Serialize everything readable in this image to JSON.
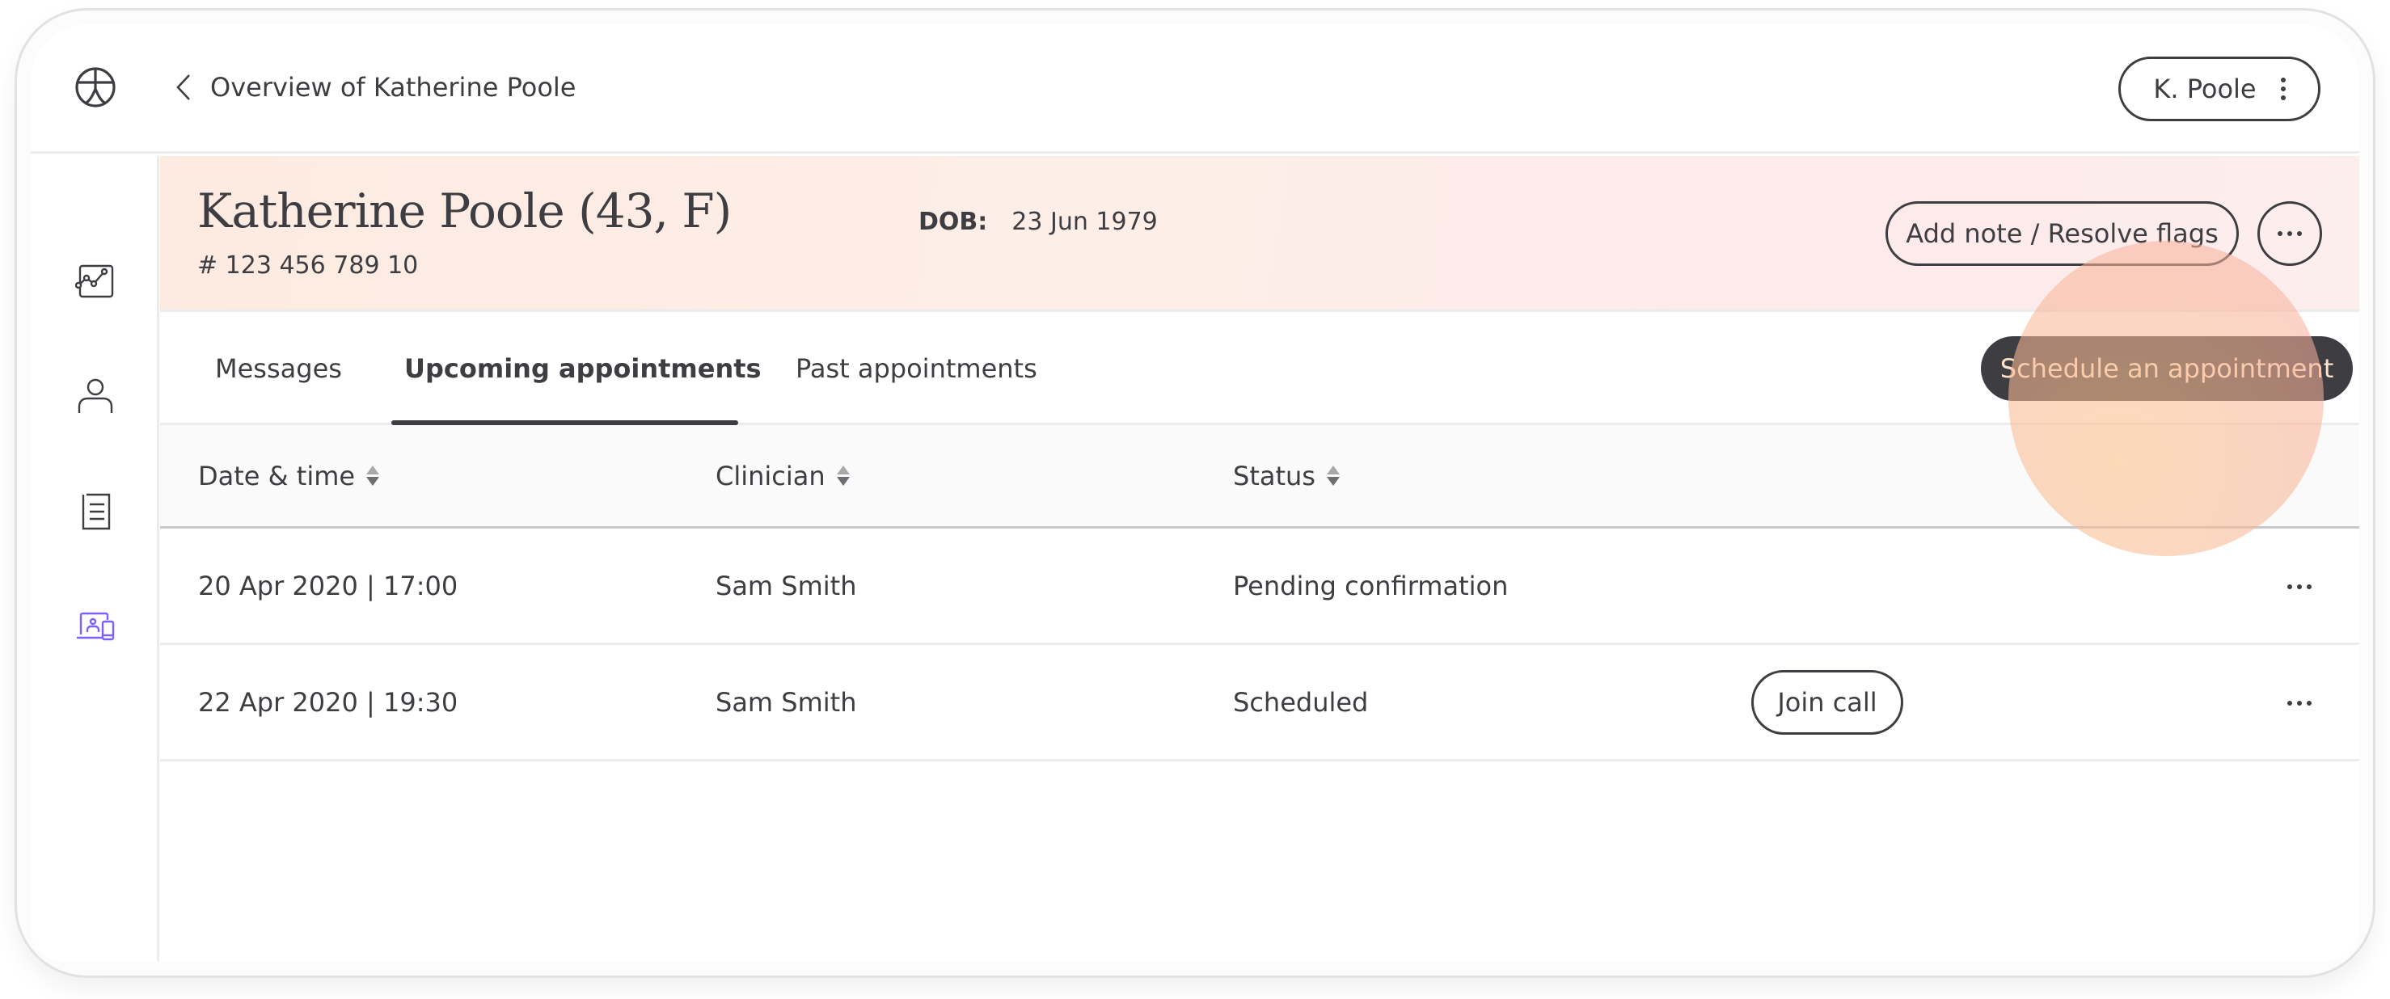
{
  "header": {
    "logo_icon": "vitruvian-circle-logo",
    "back_icon": "chevron-left-icon",
    "breadcrumb": "Overview of Katherine Poole",
    "user_button": {
      "label": "K. Poole",
      "icon": "kebab-vertical-icon"
    }
  },
  "sidebar": {
    "items": [
      {
        "name": "analytics",
        "icon": "line-chart-icon",
        "active": false
      },
      {
        "name": "profile",
        "icon": "person-icon",
        "active": false
      },
      {
        "name": "documents",
        "icon": "document-icon",
        "active": false
      },
      {
        "name": "telehealth",
        "icon": "devices-video-call-icon",
        "active": true
      }
    ],
    "active_color": "#7b61ff"
  },
  "patient": {
    "name": "Katherine Poole (43, F)",
    "id": "# 123 456 789 10",
    "dob_label": "DOB:",
    "dob_value": "23 Jun 1979",
    "add_note_button": "Add note / Resolve flags",
    "more_button_icon": "ellipsis-horizontal-icon"
  },
  "tabs": {
    "items": [
      {
        "label": "Messages",
        "active": false
      },
      {
        "label": "Upcoming appointments",
        "active": true
      },
      {
        "label": "Past appointments",
        "active": false
      }
    ],
    "schedule_button": "Schedule an appointment"
  },
  "table": {
    "columns": [
      {
        "label": "Date & time",
        "sortable": true
      },
      {
        "label": "Clinician",
        "sortable": true
      },
      {
        "label": "Status",
        "sortable": true
      }
    ],
    "rows": [
      {
        "datetime": "20 Apr 2020 | 17:00",
        "clinician": "Sam Smith",
        "status": "Pending confirmation",
        "action": null
      },
      {
        "datetime": "22 Apr 2020 | 19:30",
        "clinician": "Sam Smith",
        "status": "Scheduled",
        "action": "Join call"
      }
    ]
  },
  "colors": {
    "text": "#3d3d42",
    "band_start": "#fdebe1",
    "band_end": "#fdeeee",
    "primary_button_bg": "#3d3d42",
    "primary_button_text": "#fde3cc",
    "accent": "#7b61ff"
  }
}
